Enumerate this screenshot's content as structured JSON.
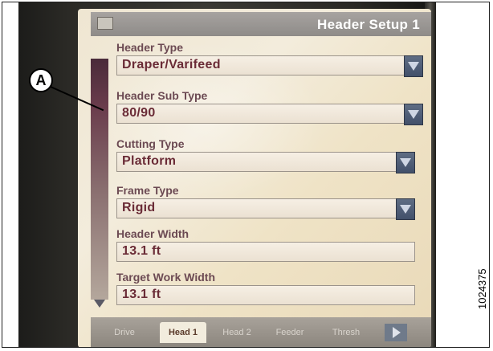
{
  "window": {
    "title": "Header Setup 1"
  },
  "fields": [
    {
      "label": "Header Type",
      "value": "Draper/Varifeed",
      "control": "dropdown"
    },
    {
      "label": "Header Sub Type",
      "value": "80/90",
      "control": "dropdown"
    },
    {
      "label": "Cutting Type",
      "value": "Platform",
      "control": "dropdown"
    },
    {
      "label": "Frame Type",
      "value": "Rigid",
      "control": "dropdown"
    },
    {
      "label": "Header Width",
      "value": "13.1  ft",
      "control": "input"
    },
    {
      "label": "Target Work Width",
      "value": "13.1  ft",
      "control": "input"
    }
  ],
  "tabs": [
    {
      "label": "Drive",
      "active": false
    },
    {
      "label": "Head 1",
      "active": true
    },
    {
      "label": "Head 2",
      "active": false
    },
    {
      "label": "Feeder",
      "active": false
    },
    {
      "label": "Thresh",
      "active": false
    }
  ],
  "icons": {
    "title": "header-setup-icon",
    "dropdown": "chevron-down-icon",
    "next_tab": "next-arrow-icon"
  },
  "callout": {
    "label": "A"
  },
  "figure_id": "1024375",
  "colors": {
    "title_bar": "#8e8b88",
    "field_value": "#6a2b36",
    "label": "#6c4a53",
    "dropdown": "#42506a"
  }
}
